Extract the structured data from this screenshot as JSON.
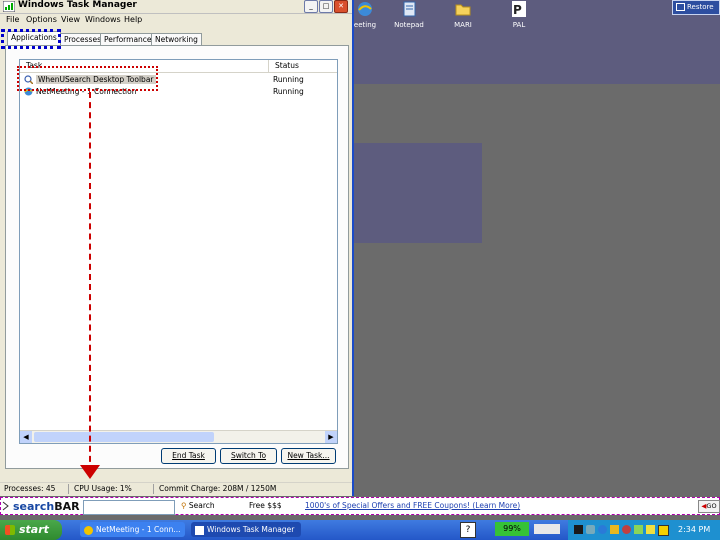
{
  "desktop": {
    "icons": [
      {
        "label": "eeting",
        "icon": "netmeeting-icon"
      },
      {
        "label": "Notepad",
        "icon": "notepad-icon"
      },
      {
        "label": "MARI",
        "icon": "folder-icon"
      },
      {
        "label": "PAL",
        "icon": "pal-icon"
      }
    ],
    "restore_label": "Restore"
  },
  "task_manager": {
    "title": "Windows Task Manager",
    "menu": [
      "File",
      "Options",
      "View",
      "Windows",
      "Help"
    ],
    "tabs": [
      "Applications",
      "Processes",
      "Performance",
      "Networking"
    ],
    "active_tab": "Applications",
    "columns": {
      "task": "Task",
      "status": "Status"
    },
    "rows": [
      {
        "task": "WhenUSearch Desktop Toolbar",
        "status": "Running",
        "selected": true
      },
      {
        "task": "NetMeeting - 1 Connection",
        "status": "Running",
        "selected": false
      }
    ],
    "buttons": {
      "end_task": "End Task",
      "switch_to": "Switch To",
      "new_task": "New Task..."
    },
    "status_bar": {
      "processes": "Processes: 45",
      "cpu": "CPU Usage: 1%",
      "commit": "Commit Charge: 208M / 1250M"
    }
  },
  "search_bar": {
    "logo_a": "search",
    "logo_b": "BAR",
    "search_label": "Search",
    "free_label": "Free $$$",
    "offer_link": "1000's of Special Offers and FREE Coupons! (Learn More)",
    "go_label": "GO"
  },
  "taskbar": {
    "start_label": "start",
    "buttons": [
      "NetMeeting - 1 Conn...",
      "Windows Task Manager"
    ],
    "battery": "99%",
    "clock": "2:34 PM"
  },
  "colors": {
    "desktop_bg": "#6b6b6b",
    "desktop_purple": "#5d5c7e",
    "taskbar_blue": "#2457c8",
    "start_green": "#2f8a2f",
    "annotation_red": "#cc0000",
    "annotation_blue": "#0000cc"
  }
}
